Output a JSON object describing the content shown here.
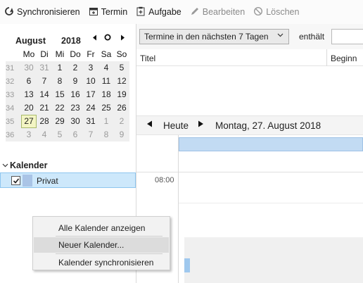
{
  "toolbar": {
    "items": [
      {
        "label": "Synchronisieren",
        "icon": "sync-icon",
        "enabled": true
      },
      {
        "label": "Termin",
        "icon": "new-event-icon",
        "enabled": true
      },
      {
        "label": "Aufgabe",
        "icon": "new-task-icon",
        "enabled": true
      },
      {
        "label": "Bearbeiten",
        "icon": "edit-icon",
        "enabled": false
      },
      {
        "label": "Löschen",
        "icon": "delete-icon",
        "enabled": false
      }
    ]
  },
  "mini_calendar": {
    "month": "August",
    "year": "2018",
    "nav_prev": "◀",
    "nav_today": "○",
    "nav_next": "▶",
    "weekday_headers": [
      "Mo",
      "Di",
      "Mi",
      "Do",
      "Fr",
      "Sa",
      "So"
    ],
    "weeks": [
      {
        "week": "31",
        "days": [
          "30",
          "31",
          "1",
          "2",
          "3",
          "4",
          "5"
        ],
        "other": [
          true,
          true,
          false,
          false,
          false,
          false,
          false
        ]
      },
      {
        "week": "32",
        "days": [
          "6",
          "7",
          "8",
          "9",
          "10",
          "11",
          "12"
        ],
        "other": [
          false,
          false,
          false,
          false,
          false,
          false,
          false
        ]
      },
      {
        "week": "33",
        "days": [
          "13",
          "14",
          "15",
          "16",
          "17",
          "18",
          "19"
        ],
        "other": [
          false,
          false,
          false,
          false,
          false,
          false,
          false
        ]
      },
      {
        "week": "34",
        "days": [
          "20",
          "21",
          "22",
          "23",
          "24",
          "25",
          "26"
        ],
        "other": [
          false,
          false,
          false,
          false,
          false,
          false,
          false
        ]
      },
      {
        "week": "35",
        "days": [
          "27",
          "28",
          "29",
          "30",
          "31",
          "1",
          "2"
        ],
        "other": [
          false,
          false,
          false,
          false,
          false,
          true,
          true
        ]
      },
      {
        "week": "36",
        "days": [
          "3",
          "4",
          "5",
          "6",
          "7",
          "8",
          "9"
        ],
        "other": [
          true,
          true,
          true,
          true,
          true,
          true,
          true
        ]
      }
    ],
    "today": "27"
  },
  "calendar_list": {
    "header": "Kalender",
    "items": [
      {
        "name": "Privat",
        "checked": true,
        "color": "#a9c4e6"
      }
    ]
  },
  "filter_bar": {
    "select_value": "Termine in den nächsten 7 Tagen",
    "contains_label": "enthält",
    "search_value": ""
  },
  "event_list": {
    "columns": [
      "Titel",
      "Beginn"
    ]
  },
  "day_nav": {
    "prev": "◀",
    "today_label": "Heute",
    "next": "▶",
    "date": "Montag, 27. August 2018"
  },
  "day_view": {
    "time_label": "08:00"
  },
  "context_menu": {
    "items": [
      {
        "label": "Alle Kalender anzeigen",
        "hover": false
      },
      {
        "label": "Neuer Kalender...",
        "hover": true
      },
      {
        "label": "Kalender synchronisieren",
        "hover": false
      }
    ]
  },
  "colors": {
    "selection": "#cde8fb",
    "today_highlight": "#f3f5c4",
    "calendar_privat": "#a9c4e6",
    "allday_bar": "#c2dbf3"
  }
}
